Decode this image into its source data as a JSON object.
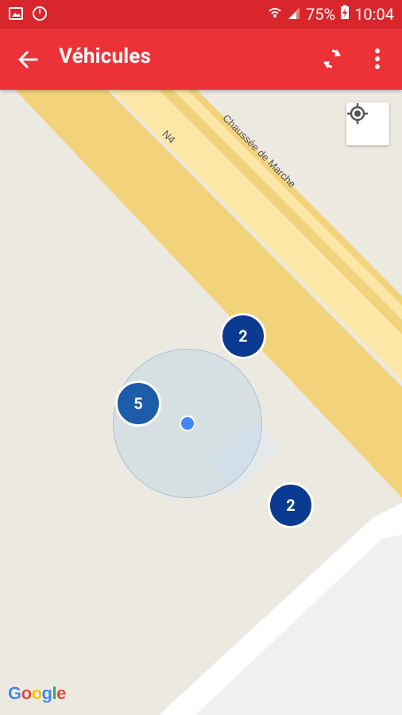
{
  "status_bar": {
    "battery_percent": "75%",
    "time": "10:04"
  },
  "app_bar": {
    "title": "Véhicules",
    "back_icon": "arrow-left-icon",
    "refresh_icon": "refresh-icon",
    "more_icon": "more-vertical-icon"
  },
  "map": {
    "road_labels": [
      "N4",
      "Chaussée de Marche"
    ],
    "clusters": [
      {
        "count": "2"
      },
      {
        "count": "5"
      },
      {
        "count": "2"
      }
    ],
    "attribution": [
      "G",
      "o",
      "o",
      "g",
      "l",
      "e"
    ],
    "attribution_colors": [
      "#4285f4",
      "#ea4335",
      "#fbbc05",
      "#4285f4",
      "#34a853",
      "#ea4335"
    ],
    "colors": {
      "road_fill": "#fde7a6",
      "road_edge": "#f3d27c",
      "land": "#ece9e1",
      "building": "#f3f3f3"
    }
  }
}
